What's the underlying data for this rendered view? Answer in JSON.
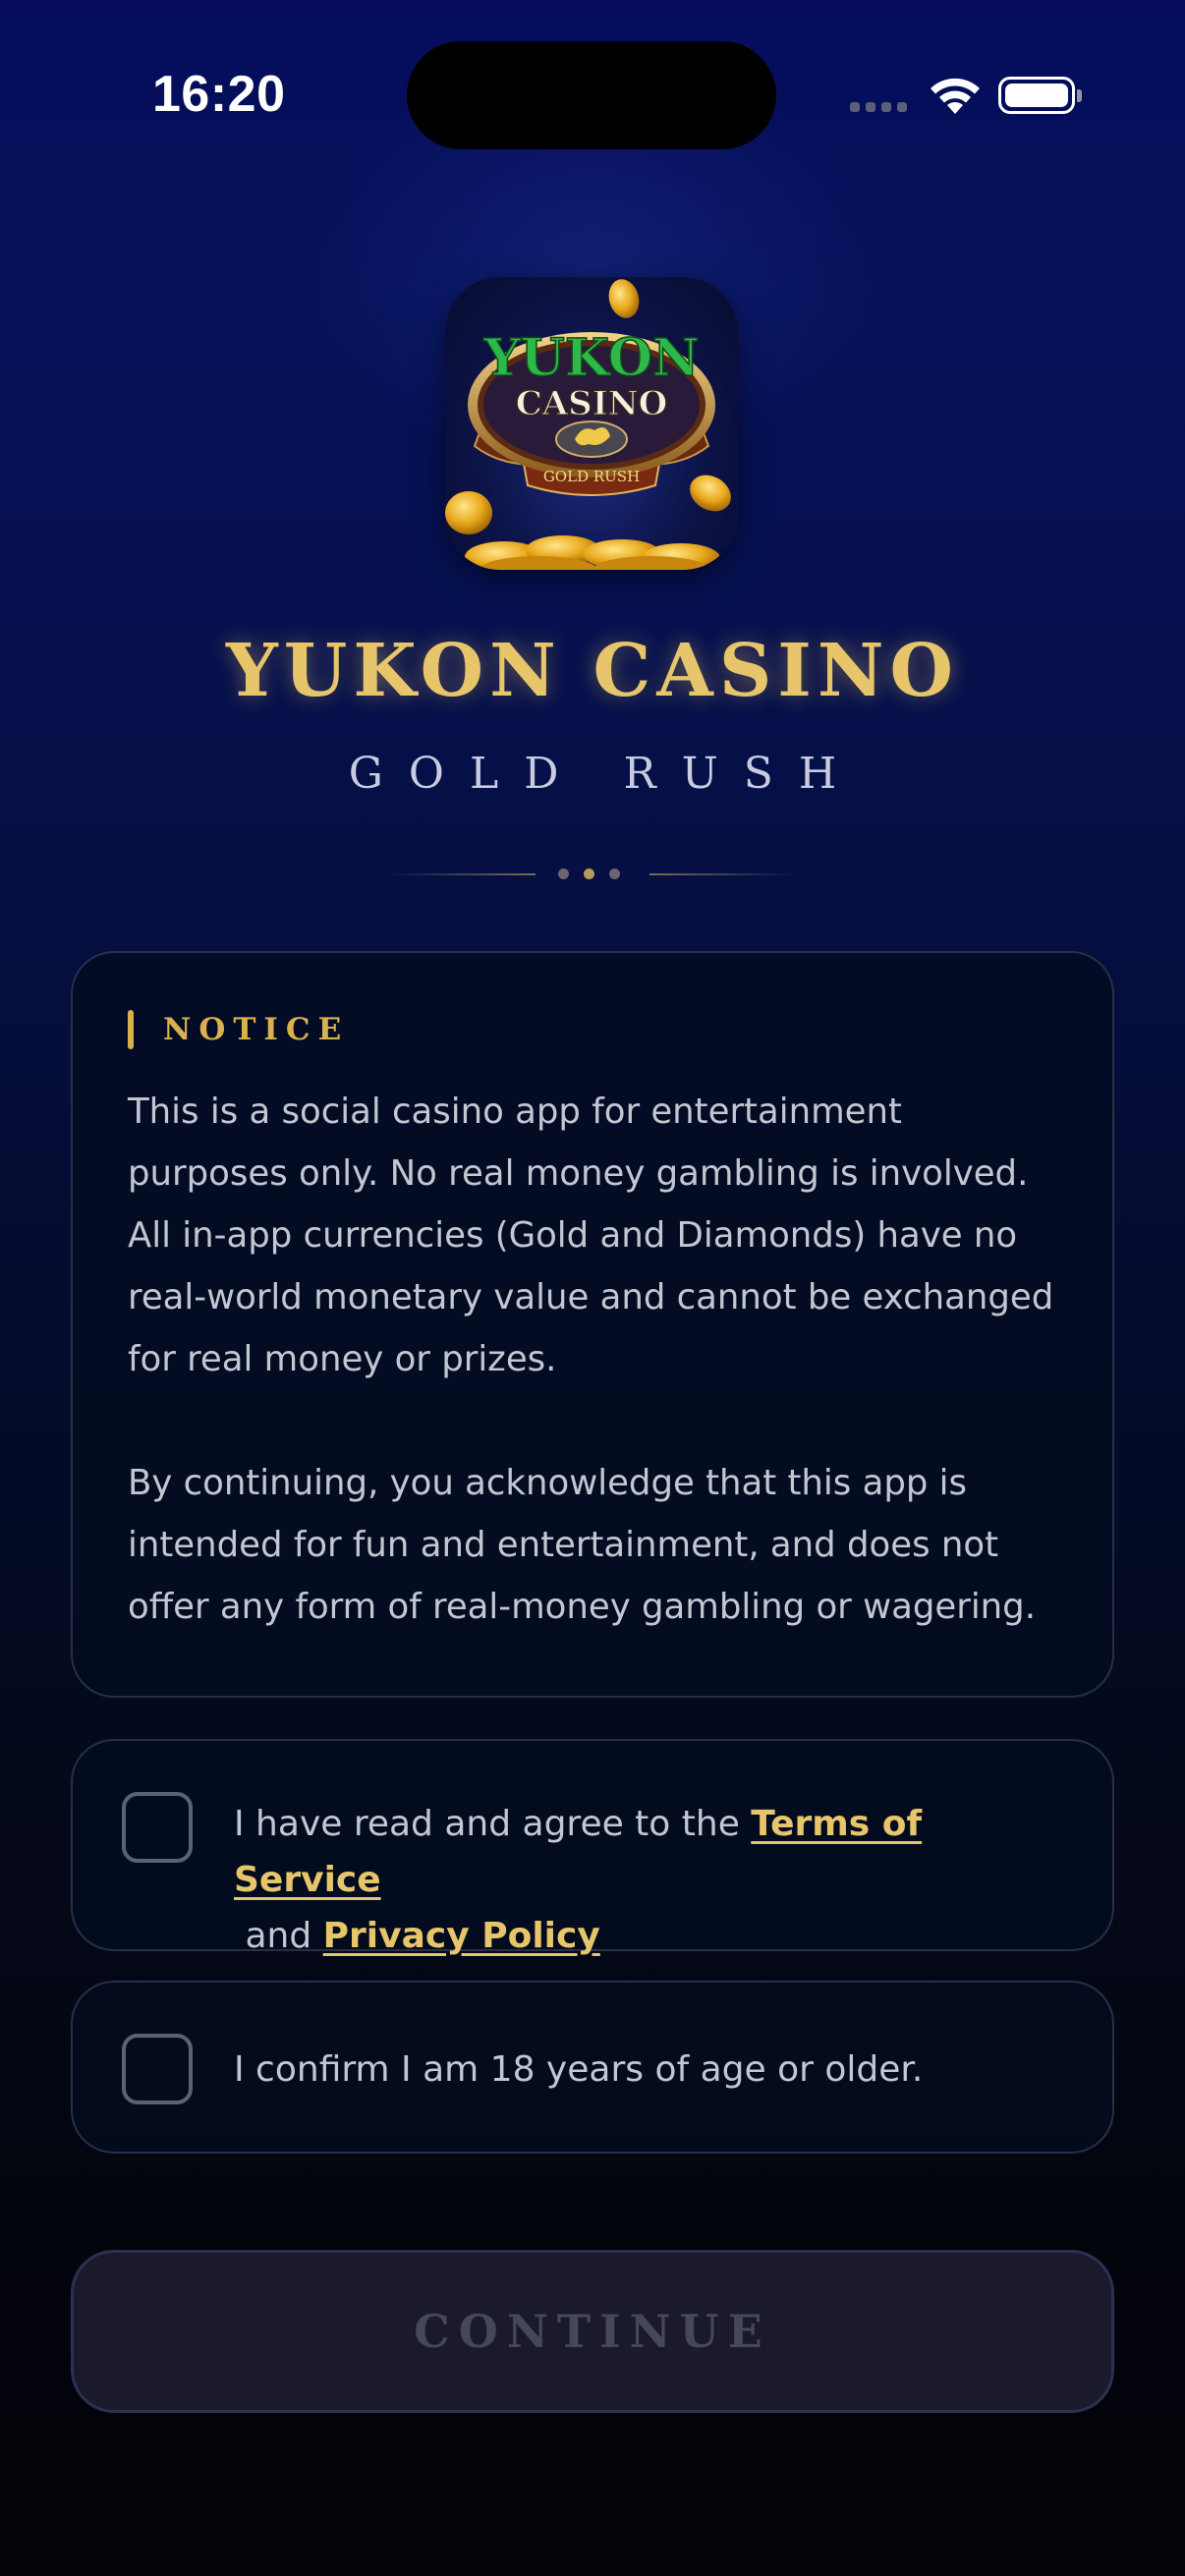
{
  "status_bar": {
    "time": "16:20"
  },
  "logo": {
    "icon": "yukon-casino-app-icon",
    "line1": "YUKON",
    "line2": "CASINO",
    "line3": "GOLD RUSH"
  },
  "header": {
    "title": "YUKON CASINO",
    "subtitle": "GOLD RUSH"
  },
  "notice": {
    "label": "NOTICE",
    "paragraph1": "This is a social casino app for entertainment purposes only. No real money gambling is involved. All in-app currencies (Gold and Diamonds) have no real-world monetary value and cannot be exchanged for real money or prizes.",
    "paragraph2": "By continuing, you acknowledge that this app is intended for fun and entertainment, and does not offer any form of real-money gambling or wagering."
  },
  "agreements": {
    "terms": {
      "prefix": "I have read and agree to the ",
      "terms_link": "Terms of Service",
      "middle": " and ",
      "privacy_link": "Privacy Policy",
      "checked": false
    },
    "age": {
      "text": "I confirm I am 18 years of age or older.",
      "checked": false
    }
  },
  "continue_button": {
    "label": "CONTINUE",
    "enabled": false
  },
  "colors": {
    "gold_accent": "#e6c56b",
    "notice_gold": "#d9b24e",
    "background_top": "#050d5c",
    "background_bottom": "#030308",
    "card_border": "#283049",
    "button_disabled_bg": "#1a1a2c",
    "button_disabled_text": "#46475a"
  }
}
